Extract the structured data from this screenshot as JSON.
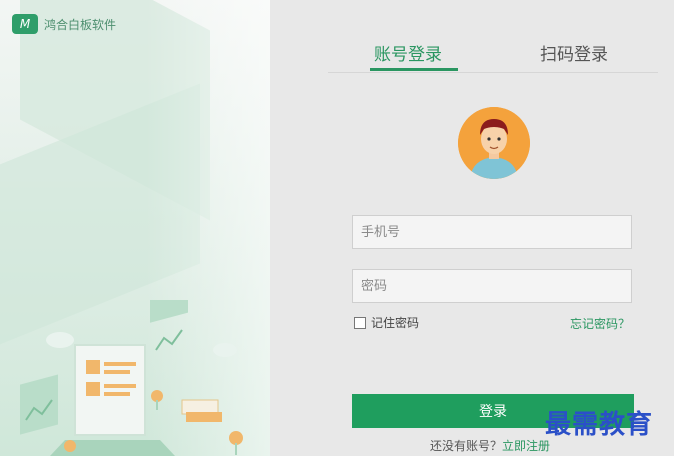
{
  "brand": {
    "name": "鸿合白板软件",
    "logo_glyph": "M"
  },
  "tabs": [
    {
      "label": "账号登录",
      "active": true
    },
    {
      "label": "扫码登录",
      "active": false
    }
  ],
  "form": {
    "phone_placeholder": "手机号",
    "password_placeholder": "密码",
    "remember_label": "记住密码",
    "forgot_label": "忘记密码？",
    "login_label": "登录",
    "register_prompt": "还没有账号？",
    "register_link": "立即注册"
  },
  "watermark": "最需教育",
  "colors": {
    "accent": "#2a9661",
    "button": "#1f9e5e"
  }
}
